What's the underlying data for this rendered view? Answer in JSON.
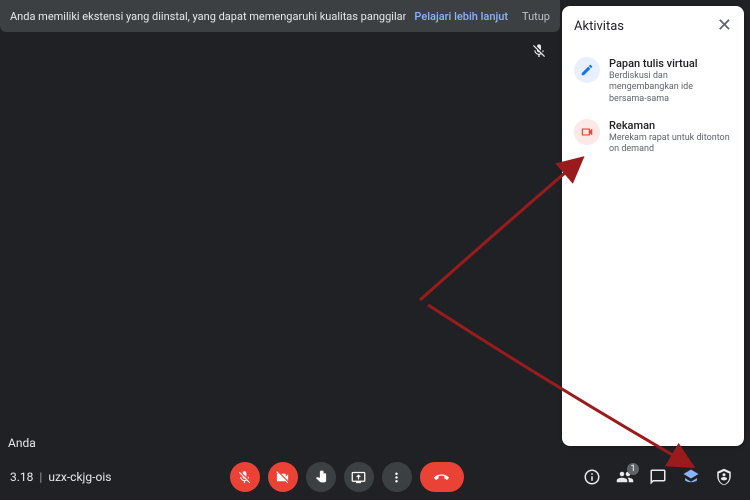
{
  "banner": {
    "message": "Anda memiliki ekstensi yang diinstal, yang dapat memengaruhi kualitas panggilan",
    "learn_more": "Pelajari lebih lanjut",
    "close": "Tutup"
  },
  "self_label": "Anda",
  "bottom": {
    "time": "3.18",
    "meeting_code": "uzx-ckjg-ois",
    "participants_count": "1"
  },
  "panel": {
    "title": "Aktivitas",
    "items": [
      {
        "title": "Papan tulis virtual",
        "desc": "Berdiskusi dan mengembangkan ide bersama-sama"
      },
      {
        "title": "Rekaman",
        "desc": "Merekam rapat untuk ditonton on demand"
      }
    ]
  }
}
